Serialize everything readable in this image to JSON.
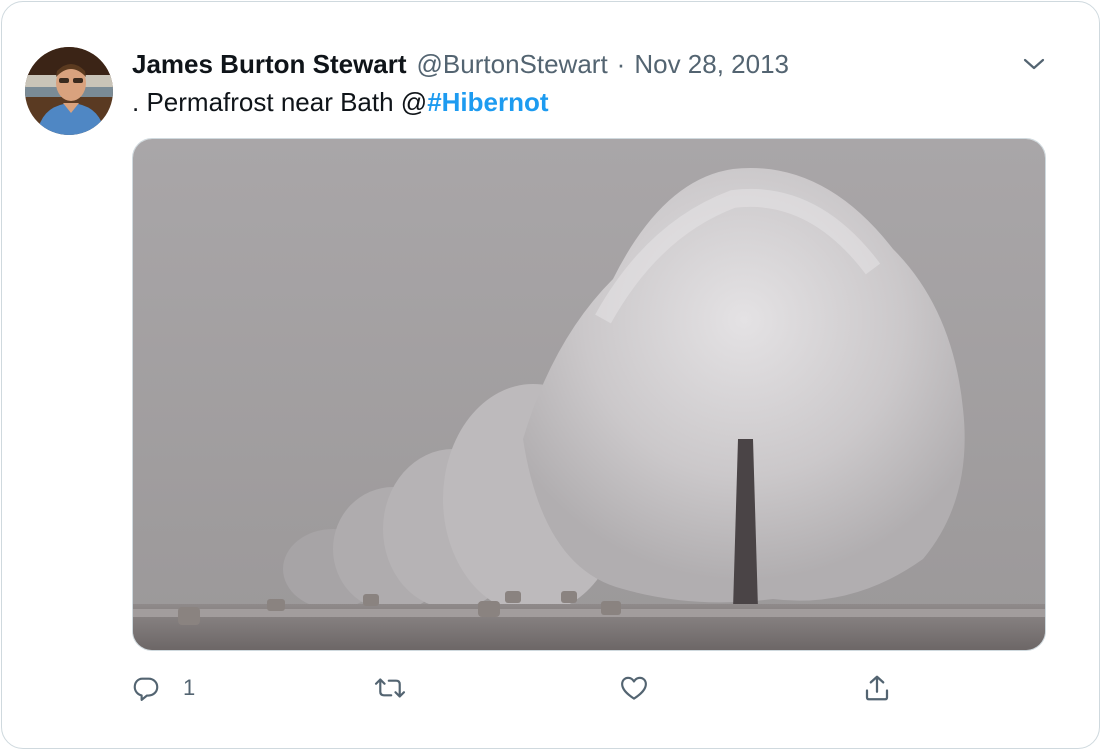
{
  "tweet": {
    "author_name": "James Burton Stewart",
    "handle": "@BurtonStewart",
    "separator": "·",
    "date": "Nov 28, 2013",
    "text_prefix": ". Permafrost near Bath @",
    "hashtag": "#Hibernot"
  },
  "actions": {
    "reply_count": "1"
  },
  "colors": {
    "link": "#1d9bf0",
    "secondary_text": "#536471",
    "border": "#cfd9de"
  },
  "icons": {
    "caret": "chevron-down-icon",
    "reply": "reply-icon",
    "retweet": "retweet-icon",
    "like": "heart-icon",
    "share": "share-icon"
  }
}
